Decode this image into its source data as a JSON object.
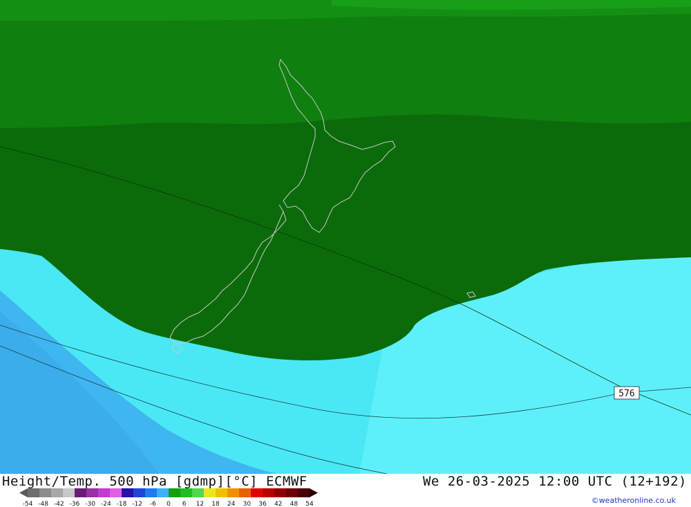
{
  "map": {
    "contour_value_label": "576",
    "fill_colors": {
      "band_dark": "#0b6b0b",
      "band_mid": "#0f7f0f",
      "band_light": "#139013",
      "band_top": "#17a017",
      "sea_cyan": "#4ae8f4",
      "sea_cyan_light": "#5ef0fa",
      "sea_blue": "#3fb6f0",
      "coast": "#c8c8c8"
    }
  },
  "footer": {
    "title": "Height/Temp. 500 hPa [gdmp][°C] ECMWF",
    "datetime": "We 26-03-2025 12:00 UTC (12+192)",
    "credit": "©weatheronline.co.uk"
  },
  "colorbar": {
    "ticks": [
      "-54",
      "-48",
      "-42",
      "-36",
      "-30",
      "-24",
      "-18",
      "-12",
      "-6",
      "0",
      "6",
      "12",
      "18",
      "24",
      "30",
      "36",
      "42",
      "48",
      "54"
    ],
    "colors": [
      "#6e6e6e",
      "#8c8c8c",
      "#a8a8a8",
      "#c8c8c8",
      "#6a1b7a",
      "#9b2fa6",
      "#c43bd0",
      "#e05fe6",
      "#2810a8",
      "#1e46d8",
      "#1e7cf0",
      "#3cb0fa",
      "#10a010",
      "#20c020",
      "#50d850",
      "#e8e820",
      "#f0c000",
      "#f09000",
      "#e86000",
      "#e00000",
      "#b80000",
      "#900000",
      "#6a0000",
      "#4a0000"
    ]
  }
}
